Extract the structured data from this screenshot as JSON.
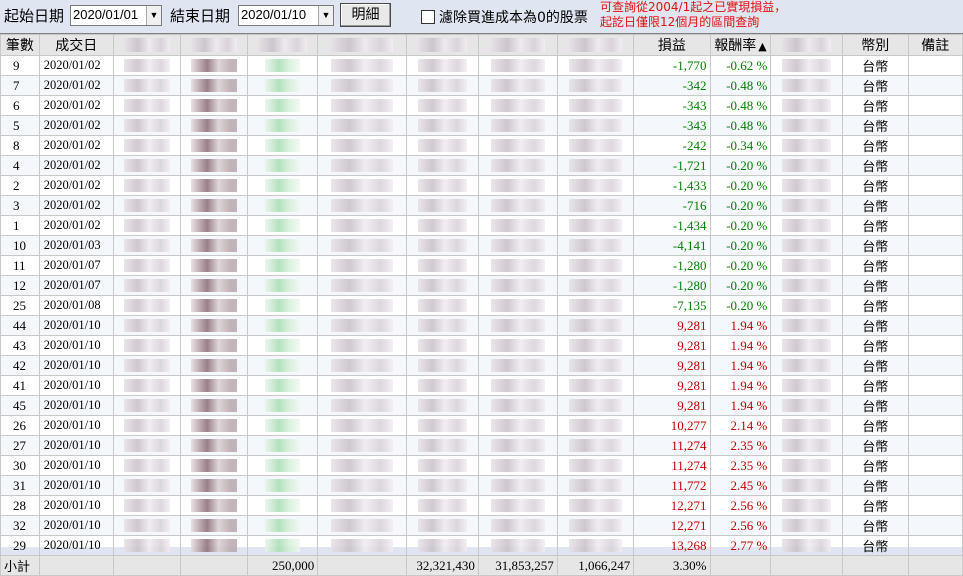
{
  "toolbar": {
    "start_label": "起始日期",
    "start_value": "2020/01/01",
    "end_label": "結束日期",
    "end_value": "2020/01/10",
    "detail_button": "明細",
    "filter_label": "濾除買進成本為0的股票",
    "notice_line1": "可查詢從2004/1起之已實現損益，",
    "notice_line2": "起訖日僅限12個月的區間查詢"
  },
  "columns": {
    "count": "筆數",
    "date": "成交日",
    "pnl": "損益",
    "rate": "報酬率",
    "rate_sort": "▲",
    "currency": "幣別",
    "note": "備註"
  },
  "rows": [
    {
      "no": "9",
      "date": "2020/01/02",
      "pnl": "-1,770",
      "rate": "-0.62 %",
      "cur": "台幣",
      "sign": "neg"
    },
    {
      "no": "7",
      "date": "2020/01/02",
      "pnl": "-342",
      "rate": "-0.48 %",
      "cur": "台幣",
      "sign": "neg"
    },
    {
      "no": "6",
      "date": "2020/01/02",
      "pnl": "-343",
      "rate": "-0.48 %",
      "cur": "台幣",
      "sign": "neg"
    },
    {
      "no": "5",
      "date": "2020/01/02",
      "pnl": "-343",
      "rate": "-0.48 %",
      "cur": "台幣",
      "sign": "neg"
    },
    {
      "no": "8",
      "date": "2020/01/02",
      "pnl": "-242",
      "rate": "-0.34 %",
      "cur": "台幣",
      "sign": "neg"
    },
    {
      "no": "4",
      "date": "2020/01/02",
      "pnl": "-1,721",
      "rate": "-0.20 %",
      "cur": "台幣",
      "sign": "neg"
    },
    {
      "no": "2",
      "date": "2020/01/02",
      "pnl": "-1,433",
      "rate": "-0.20 %",
      "cur": "台幣",
      "sign": "neg"
    },
    {
      "no": "3",
      "date": "2020/01/02",
      "pnl": "-716",
      "rate": "-0.20 %",
      "cur": "台幣",
      "sign": "neg"
    },
    {
      "no": "1",
      "date": "2020/01/02",
      "pnl": "-1,434",
      "rate": "-0.20 %",
      "cur": "台幣",
      "sign": "neg"
    },
    {
      "no": "10",
      "date": "2020/01/03",
      "pnl": "-4,141",
      "rate": "-0.20 %",
      "cur": "台幣",
      "sign": "neg"
    },
    {
      "no": "11",
      "date": "2020/01/07",
      "pnl": "-1,280",
      "rate": "-0.20 %",
      "cur": "台幣",
      "sign": "neg"
    },
    {
      "no": "12",
      "date": "2020/01/07",
      "pnl": "-1,280",
      "rate": "-0.20 %",
      "cur": "台幣",
      "sign": "neg"
    },
    {
      "no": "25",
      "date": "2020/01/08",
      "pnl": "-7,135",
      "rate": "-0.20 %",
      "cur": "台幣",
      "sign": "neg"
    },
    {
      "no": "44",
      "date": "2020/01/10",
      "pnl": "9,281",
      "rate": "1.94 %",
      "cur": "台幣",
      "sign": "pos"
    },
    {
      "no": "43",
      "date": "2020/01/10",
      "pnl": "9,281",
      "rate": "1.94 %",
      "cur": "台幣",
      "sign": "pos"
    },
    {
      "no": "42",
      "date": "2020/01/10",
      "pnl": "9,281",
      "rate": "1.94 %",
      "cur": "台幣",
      "sign": "pos"
    },
    {
      "no": "41",
      "date": "2020/01/10",
      "pnl": "9,281",
      "rate": "1.94 %",
      "cur": "台幣",
      "sign": "pos"
    },
    {
      "no": "45",
      "date": "2020/01/10",
      "pnl": "9,281",
      "rate": "1.94 %",
      "cur": "台幣",
      "sign": "pos"
    },
    {
      "no": "26",
      "date": "2020/01/10",
      "pnl": "10,277",
      "rate": "2.14 %",
      "cur": "台幣",
      "sign": "pos"
    },
    {
      "no": "27",
      "date": "2020/01/10",
      "pnl": "11,274",
      "rate": "2.35 %",
      "cur": "台幣",
      "sign": "pos"
    },
    {
      "no": "30",
      "date": "2020/01/10",
      "pnl": "11,274",
      "rate": "2.35 %",
      "cur": "台幣",
      "sign": "pos"
    },
    {
      "no": "31",
      "date": "2020/01/10",
      "pnl": "11,772",
      "rate": "2.45 %",
      "cur": "台幣",
      "sign": "pos"
    },
    {
      "no": "28",
      "date": "2020/01/10",
      "pnl": "12,271",
      "rate": "2.56 %",
      "cur": "台幣",
      "sign": "pos"
    },
    {
      "no": "32",
      "date": "2020/01/10",
      "pnl": "12,271",
      "rate": "2.56 %",
      "cur": "台幣",
      "sign": "pos"
    },
    {
      "no": "29",
      "date": "2020/01/10",
      "pnl": "13,268",
      "rate": "2.77 %",
      "cur": "台幣",
      "sign": "pos"
    }
  ],
  "total": {
    "label": "小計",
    "qty": "250,000",
    "cost": "32,321,430",
    "proceeds": "31,853,257",
    "pnl": "1,066,247",
    "rate": "3.30%"
  },
  "colors": {
    "positive": "#c00000",
    "negative": "#008000",
    "notice": "#e01010"
  }
}
